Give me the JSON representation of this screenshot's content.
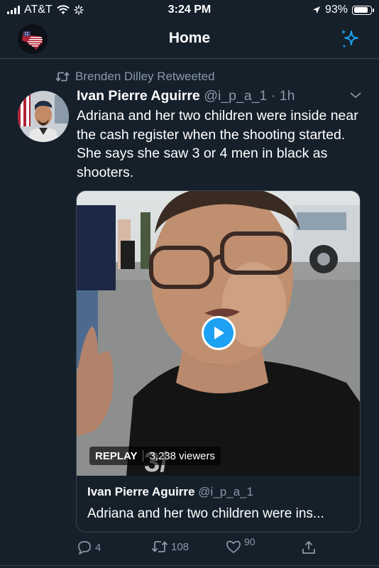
{
  "status_bar": {
    "carrier": "AT&T",
    "time": "3:24 PM",
    "battery": "93%",
    "battery_level": 0.93
  },
  "header": {
    "title": "Home",
    "profile_icon": "texas-flag-avatar",
    "action_icon": "sparkle-icon"
  },
  "tweet": {
    "retweet_label": "Brenden Dilley Retweeted",
    "author_name": "Ivan Pierre Aguirre",
    "author_meta": "@i_p_a_1 · 1h",
    "text": "Adriana and her two children were inside near the cash register when the shooting started. She says she saw 3 or 4 men in black as shooters.",
    "media": {
      "replay_label": "REPLAY",
      "viewers": "3,238 viewers",
      "quote_name": "Ivan Pierre Aguirre",
      "quote_handle": "@i_p_a_1",
      "quote_text": "Adriana and her two children were ins..."
    },
    "actions": {
      "replies": "4",
      "retweets": "108",
      "likes": "90"
    }
  },
  "colors": {
    "background": "#15202b",
    "accent": "#1da1f2",
    "muted": "#8899a6",
    "divider": "#38444d"
  }
}
